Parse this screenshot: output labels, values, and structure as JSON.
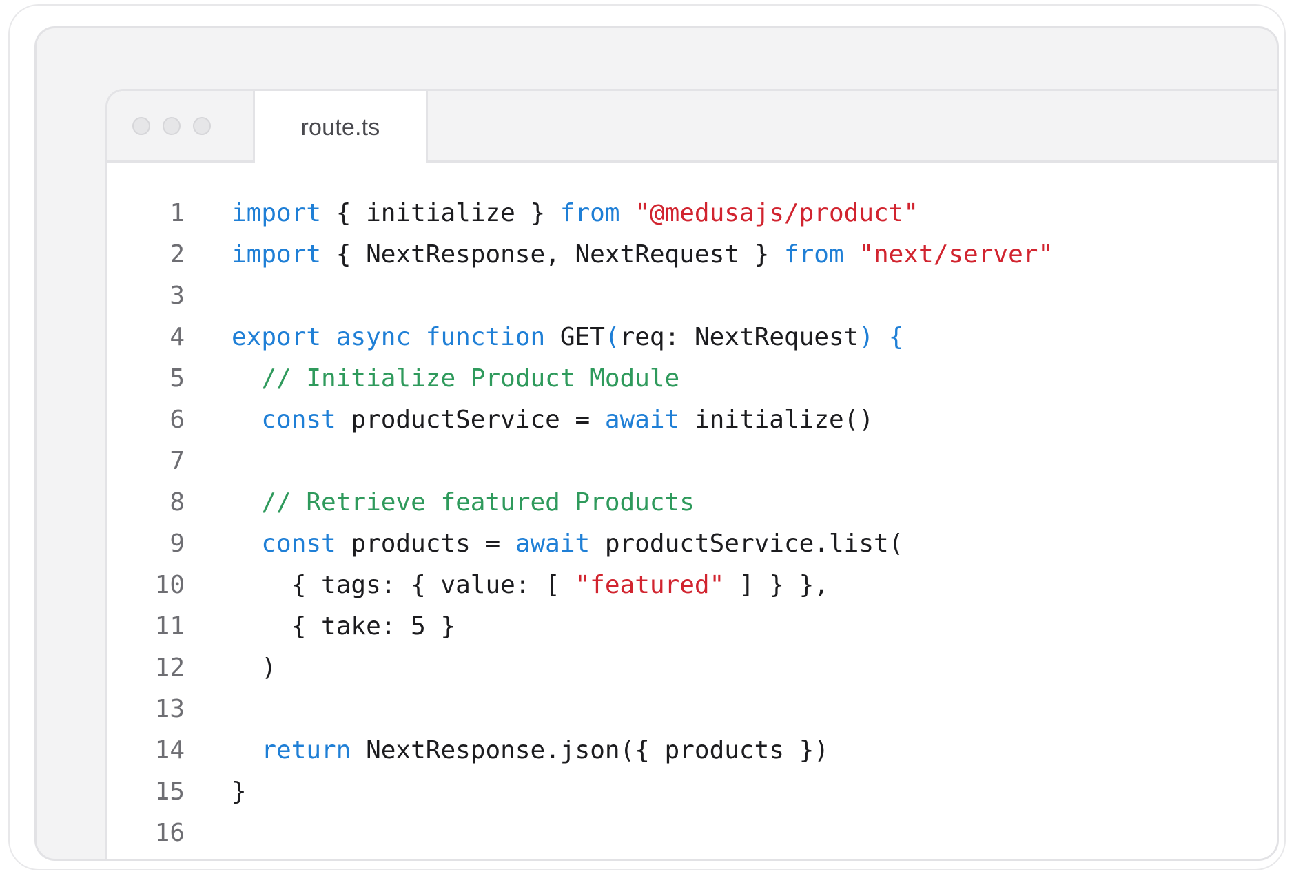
{
  "tab": {
    "label": "route.ts"
  },
  "colors": {
    "keyword": "#1f7fd6",
    "string": "#d1242f",
    "comment": "#2f9a5c",
    "plain": "#1c1c1f",
    "line_number": "#6e6e73"
  },
  "code": {
    "lines": [
      {
        "number": "1",
        "tokens": [
          {
            "type": "kw",
            "text": "import"
          },
          {
            "type": "plain",
            "text": " { initialize } "
          },
          {
            "type": "kw",
            "text": "from"
          },
          {
            "type": "plain",
            "text": " "
          },
          {
            "type": "str",
            "text": "\"@medusajs/product\""
          }
        ]
      },
      {
        "number": "2",
        "tokens": [
          {
            "type": "kw",
            "text": "import"
          },
          {
            "type": "plain",
            "text": " { NextResponse, NextRequest } "
          },
          {
            "type": "kw",
            "text": "from"
          },
          {
            "type": "plain",
            "text": " "
          },
          {
            "type": "str",
            "text": "\"next/server\""
          }
        ]
      },
      {
        "number": "3",
        "tokens": []
      },
      {
        "number": "4",
        "tokens": [
          {
            "type": "kw",
            "text": "export"
          },
          {
            "type": "plain",
            "text": " "
          },
          {
            "type": "kw",
            "text": "async"
          },
          {
            "type": "plain",
            "text": " "
          },
          {
            "type": "kw",
            "text": "function"
          },
          {
            "type": "plain",
            "text": " GET"
          },
          {
            "type": "kw",
            "text": "("
          },
          {
            "type": "plain",
            "text": "req: NextRequest"
          },
          {
            "type": "kw",
            "text": ") {"
          }
        ]
      },
      {
        "number": "5",
        "tokens": [
          {
            "type": "plain",
            "text": "  "
          },
          {
            "type": "cmt",
            "text": "// Initialize Product Module"
          }
        ]
      },
      {
        "number": "6",
        "tokens": [
          {
            "type": "plain",
            "text": "  "
          },
          {
            "type": "kw",
            "text": "const"
          },
          {
            "type": "plain",
            "text": " productService = "
          },
          {
            "type": "kw",
            "text": "await"
          },
          {
            "type": "plain",
            "text": " initialize()"
          }
        ]
      },
      {
        "number": "7",
        "tokens": []
      },
      {
        "number": "8",
        "tokens": [
          {
            "type": "plain",
            "text": "  "
          },
          {
            "type": "cmt",
            "text": "// Retrieve featured Products"
          }
        ]
      },
      {
        "number": "9",
        "tokens": [
          {
            "type": "plain",
            "text": "  "
          },
          {
            "type": "kw",
            "text": "const"
          },
          {
            "type": "plain",
            "text": " products = "
          },
          {
            "type": "kw",
            "text": "await"
          },
          {
            "type": "plain",
            "text": " productService.list("
          }
        ]
      },
      {
        "number": "10",
        "tokens": [
          {
            "type": "plain",
            "text": "    { tags: { value: [ "
          },
          {
            "type": "str",
            "text": "\"featured\""
          },
          {
            "type": "plain",
            "text": " ] } },"
          }
        ]
      },
      {
        "number": "11",
        "tokens": [
          {
            "type": "plain",
            "text": "    { take: 5 }"
          }
        ]
      },
      {
        "number": "12",
        "tokens": [
          {
            "type": "plain",
            "text": "  )"
          }
        ]
      },
      {
        "number": "13",
        "tokens": []
      },
      {
        "number": "14",
        "tokens": [
          {
            "type": "plain",
            "text": "  "
          },
          {
            "type": "kw",
            "text": "return"
          },
          {
            "type": "plain",
            "text": " NextResponse.json({ products })"
          }
        ]
      },
      {
        "number": "15",
        "tokens": [
          {
            "type": "plain",
            "text": "}"
          }
        ]
      },
      {
        "number": "16",
        "tokens": []
      }
    ]
  }
}
